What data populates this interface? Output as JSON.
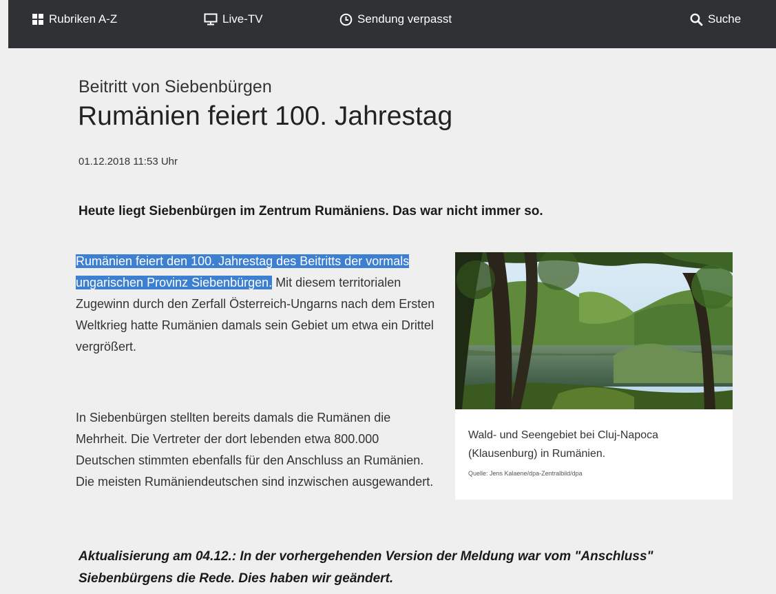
{
  "nav": {
    "rubriken": "Rubriken A-Z",
    "live_tv": "Live-TV",
    "sendung_verpasst": "Sendung verpasst",
    "suche": "Suche",
    "icons": [
      "grid-icon",
      "monitor-icon",
      "clock-icon",
      "search-icon"
    ]
  },
  "article": {
    "dachzeile": "Beitritt von Siebenbürgen",
    "headline": "Rumänien feiert 100. Jahrestag",
    "date": "01.12.2018 11:53 Uhr",
    "teaser": "Heute liegt Siebenbürgen im Zentrum Rumäniens. Das war nicht immer so.",
    "p1_highlight": "Rumänien feiert den 100. Jahrestag des Beitritts der vormals ungarischen Provinz Siebenbürgen.",
    "p1_rest": " Mit diesem territorialen Zugewinn durch den Zerfall Österreich-Ungarns nach dem Ersten Weltkrieg hatte Rumänien damals sein Gebiet um etwa ein Drittel vergrößert.",
    "p2": "In Siebenbürgen stellten bereits damals die Rumänen die Mehrheit. Die Vertreter der dort lebenden etwa 800.000 Deutschen stimmten ebenfalls für den Anschluss an Rumänien. Die meisten Rumäniendeutschen sind inzwischen ausgewandert.",
    "update": "Aktualisierung am 04.12.: In der vorhergehenden Version der Meldung war vom \"Anschluss\" Siebenbürgens die Rede. Dies haben wir geändert."
  },
  "figure": {
    "caption": "Wald- und Seengebiet bei Cluj-Napoca (Klausenburg) in Rumänien.",
    "source": "Quelle: Jens Kalaene/dpa-Zentralbild/dpa"
  },
  "colors": {
    "topbar": "#2f3135",
    "background": "#efefef",
    "selection": "#3d7fd0"
  }
}
